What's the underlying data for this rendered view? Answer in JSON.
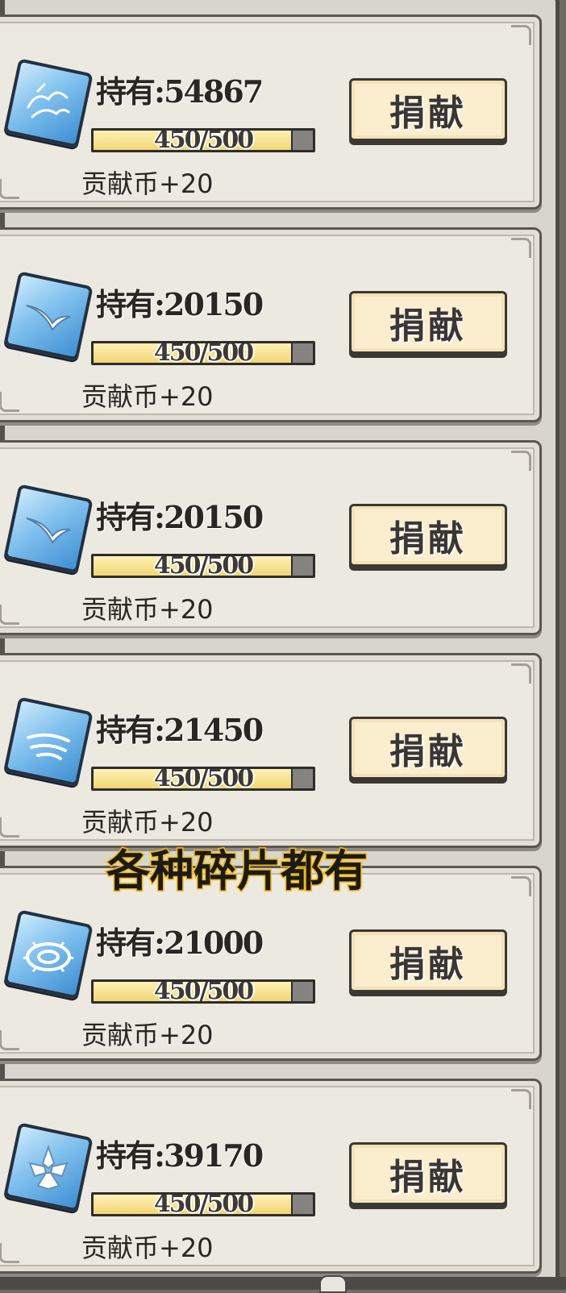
{
  "caption": "各种碎片都有",
  "items": [
    {
      "owned_label": "持有:54867",
      "progress_text": "450/500",
      "progress": 0.9,
      "reward": "贡献币+20",
      "button": "捐献",
      "icon": "cloud-pattern-icon"
    },
    {
      "owned_label": "持有:20150",
      "progress_text": "450/500",
      "progress": 0.9,
      "reward": "贡献币+20",
      "button": "捐献",
      "icon": "bird-wing-icon"
    },
    {
      "owned_label": "持有:20150",
      "progress_text": "450/500",
      "progress": 0.9,
      "reward": "贡献币+20",
      "button": "捐献",
      "icon": "bird-wing-icon"
    },
    {
      "owned_label": "持有:21450",
      "progress_text": "450/500",
      "progress": 0.9,
      "reward": "贡献币+20",
      "button": "捐献",
      "icon": "wind-streak-icon"
    },
    {
      "owned_label": "持有:21000",
      "progress_text": "450/500",
      "progress": 0.9,
      "reward": "贡献币+20",
      "button": "捐献",
      "icon": "gear-ring-icon"
    },
    {
      "owned_label": "持有:39170",
      "progress_text": "450/500",
      "progress": 0.9,
      "reward": "贡献币+20",
      "button": "捐献",
      "icon": "crystal-flower-icon"
    }
  ],
  "colors": {
    "panel": "#ece9e1",
    "button": "#fbeecf",
    "bar_fill": "#f1d575",
    "caption_stroke": "#f5b90f"
  }
}
